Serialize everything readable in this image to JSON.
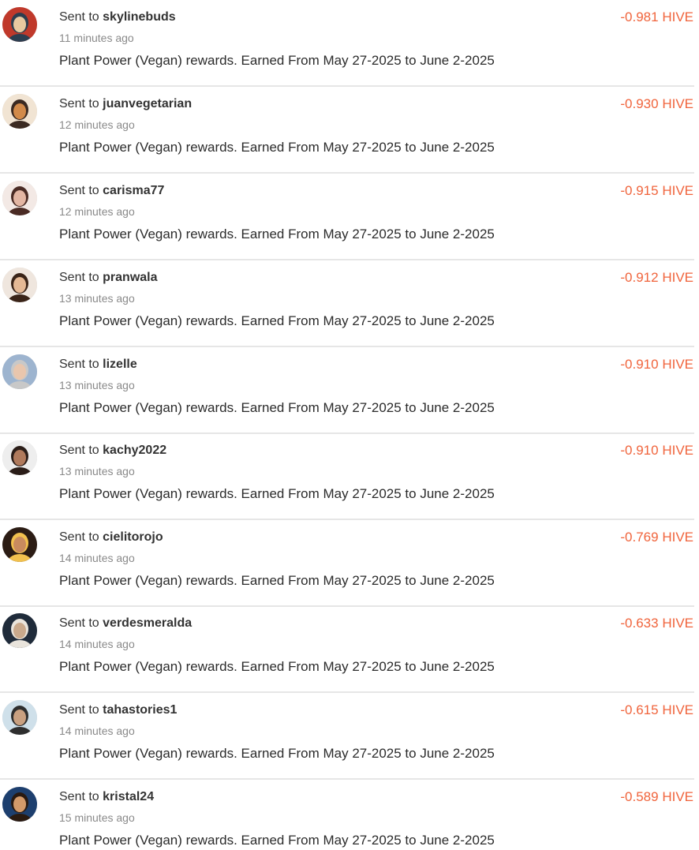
{
  "transfers": [
    {
      "prefix": "Sent to",
      "user": "skylinebuds",
      "time": "11 minutes ago",
      "memo": "Plant Power (Vegan) rewards. Earned From May 27-2025 to June 2-2025",
      "amount": "-0.981 HIVE",
      "avatar_colors": [
        "#c0392b",
        "#2c3e50",
        "#e8c9a0"
      ]
    },
    {
      "prefix": "Sent to",
      "user": "juanvegetarian",
      "time": "12 minutes ago",
      "memo": "Plant Power (Vegan) rewards. Earned From May 27-2025 to June 2-2025",
      "amount": "-0.930 HIVE",
      "avatar_colors": [
        "#f1e4d3",
        "#3b2a22",
        "#d28a4a"
      ]
    },
    {
      "prefix": "Sent to",
      "user": "carisma77",
      "time": "12 minutes ago",
      "memo": "Plant Power (Vegan) rewards. Earned From May 27-2025 to June 2-2025",
      "amount": "-0.915 HIVE",
      "avatar_colors": [
        "#f3e9e5",
        "#4a2b24",
        "#e3b6a3"
      ]
    },
    {
      "prefix": "Sent to",
      "user": "pranwala",
      "time": "13 minutes ago",
      "memo": "Plant Power (Vegan) rewards. Earned From May 27-2025 to June 2-2025",
      "amount": "-0.912 HIVE",
      "avatar_colors": [
        "#efe6de",
        "#3a2418",
        "#e5b995"
      ]
    },
    {
      "prefix": "Sent to",
      "user": "lizelle",
      "time": "13 minutes ago",
      "memo": "Plant Power (Vegan) rewards. Earned From May 27-2025 to June 2-2025",
      "amount": "-0.910 HIVE",
      "avatar_colors": [
        "#9db4cf",
        "#c8c8c8",
        "#e9c6ad"
      ]
    },
    {
      "prefix": "Sent to",
      "user": "kachy2022",
      "time": "13 minutes ago",
      "memo": "Plant Power (Vegan) rewards. Earned From May 27-2025 to June 2-2025",
      "amount": "-0.910 HIVE",
      "avatar_colors": [
        "#eeeeee",
        "#2a1d18",
        "#b07a5c"
      ]
    },
    {
      "prefix": "Sent to",
      "user": "cielitorojo",
      "time": "14 minutes ago",
      "memo": "Plant Power (Vegan) rewards. Earned From May 27-2025 to June 2-2025",
      "amount": "-0.769 HIVE",
      "avatar_colors": [
        "#2b1c14",
        "#f2c14e",
        "#c98b5e"
      ]
    },
    {
      "prefix": "Sent to",
      "user": "verdesmeralda",
      "time": "14 minutes ago",
      "memo": "Plant Power (Vegan) rewards. Earned From May 27-2025 to June 2-2025",
      "amount": "-0.633 HIVE",
      "avatar_colors": [
        "#1f2b3a",
        "#e9e4dc",
        "#c9a98c"
      ]
    },
    {
      "prefix": "Sent to",
      "user": "tahastories1",
      "time": "14 minutes ago",
      "memo": "Plant Power (Vegan) rewards. Earned From May 27-2025 to June 2-2025",
      "amount": "-0.615 HIVE",
      "avatar_colors": [
        "#cfe0ea",
        "#2e2e2e",
        "#c9a080"
      ]
    },
    {
      "prefix": "Sent to",
      "user": "kristal24",
      "time": "15 minutes ago",
      "memo": "Plant Power (Vegan) rewards. Earned From May 27-2025 to June 2-2025",
      "amount": "-0.589 HIVE",
      "avatar_colors": [
        "#1d3f6e",
        "#2a1a10",
        "#d39a6a"
      ]
    }
  ],
  "colors": {
    "amount": "#f0643c",
    "divider": "#e6e6e6",
    "time": "#8a8a8a"
  }
}
